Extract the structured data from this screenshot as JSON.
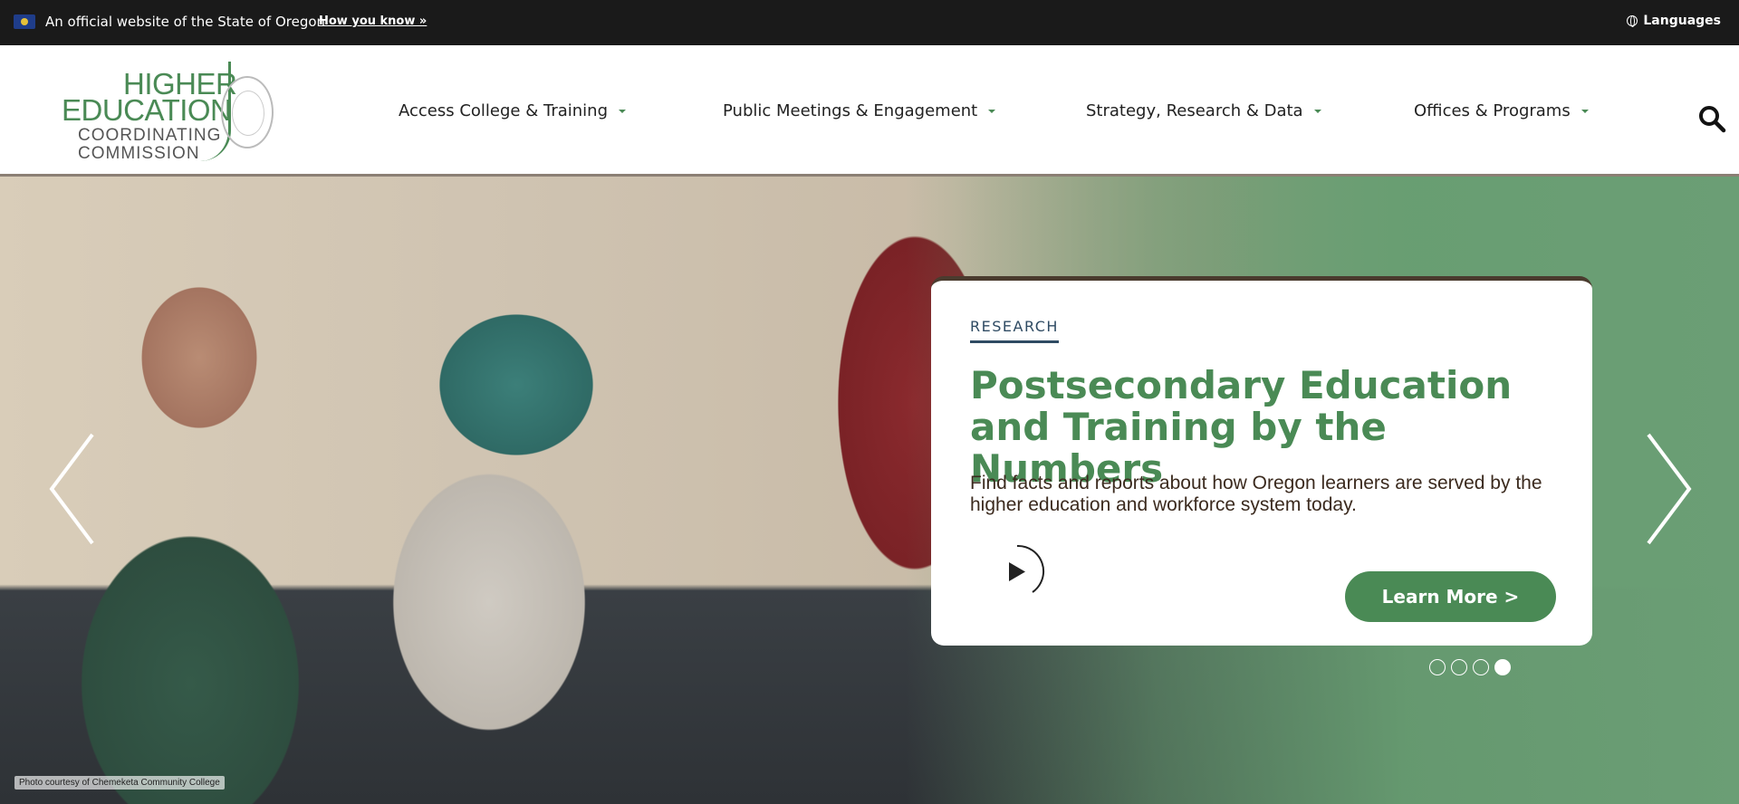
{
  "topbar": {
    "official_text": "An official website of the State of Oregon",
    "how_you_know": "How you know »",
    "languages": "Languages"
  },
  "logo": {
    "line1": "HIGHER",
    "line2": "EDUCATION",
    "line3": "COORDINATING",
    "line4": "COMMISSION"
  },
  "nav": {
    "items": [
      {
        "label": "Access College & Training"
      },
      {
        "label": "Public Meetings & Engagement"
      },
      {
        "label": "Strategy, Research & Data"
      },
      {
        "label": "Offices & Programs"
      }
    ]
  },
  "hero": {
    "photo_credit": "Photo courtesy of Chemeketa Community College",
    "card": {
      "eyebrow": "RESEARCH",
      "title": "Postsecondary Education and Training by the Numbers",
      "description": "Find facts and reports about how Oregon learners are served by the higher education and workforce system today.",
      "cta": "Learn More >"
    },
    "slides_total": 4,
    "active_slide": 4
  },
  "colors": {
    "brand_green": "#4a8a55",
    "topbar_bg": "#1a1a1a",
    "eyebrow_blue": "#2f4b63"
  }
}
